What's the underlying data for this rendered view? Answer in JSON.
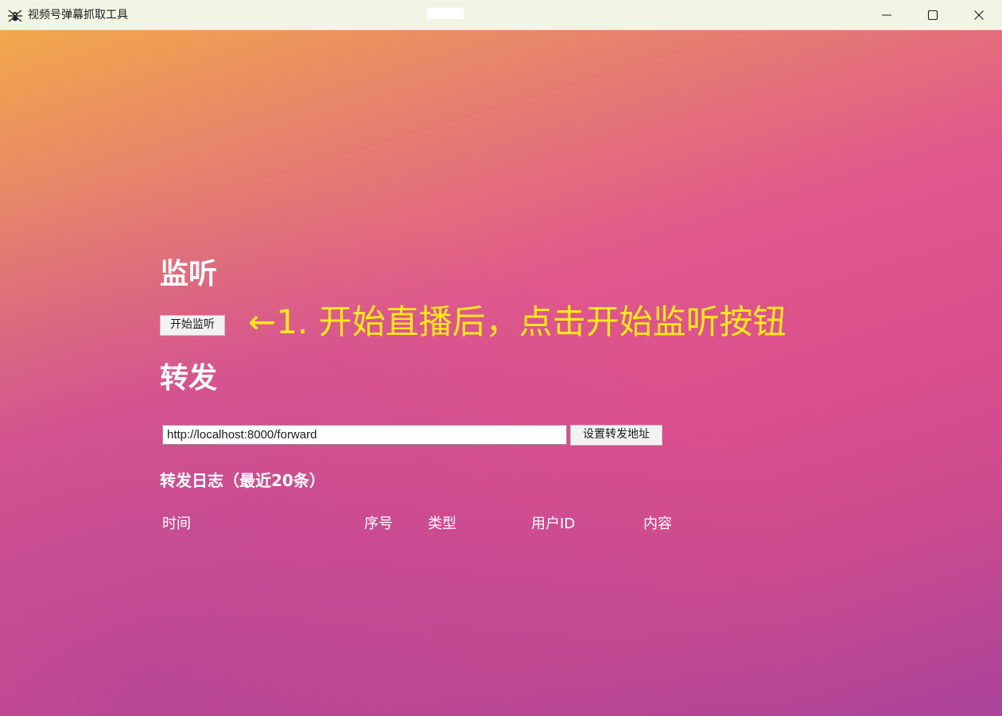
{
  "window": {
    "title": "视频号弹幕抓取工具",
    "app_icon": "spider-icon",
    "controls": {
      "minimize_icon": "minimize-icon",
      "maximize_icon": "maximize-icon",
      "close_icon": "close-icon"
    }
  },
  "listen": {
    "heading": "监听",
    "start_button": "开始监听",
    "hint": "←1. 开始直播后，点击开始监听按钮",
    "hint_color": "#ffe81a"
  },
  "forward": {
    "heading": "转发",
    "url_value": "http://localhost:8000/forward",
    "set_button": "设置转发地址"
  },
  "log": {
    "title": "转发日志（最近20条）",
    "columns": [
      "时间",
      "序号",
      "类型",
      "用户ID",
      "内容"
    ],
    "rows": []
  },
  "colors": {
    "gradient_top_right": "#f2a84a",
    "gradient_middle": "#e0588c",
    "gradient_bottom_left": "#a9439b"
  }
}
